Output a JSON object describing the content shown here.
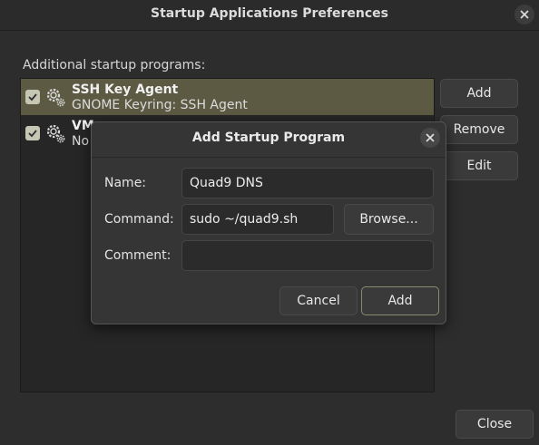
{
  "window": {
    "title": "Startup Applications Preferences"
  },
  "list": {
    "label": "Additional startup programs:",
    "items": [
      {
        "name": "SSH Key Agent",
        "description": "GNOME Keyring: SSH Agent",
        "checked": true,
        "selected": true,
        "icon": "gear-icon"
      },
      {
        "name": "VMw",
        "description": "No",
        "checked": true,
        "selected": false,
        "icon": "gear-icon"
      }
    ]
  },
  "buttons": {
    "add": "Add",
    "remove": "Remove",
    "edit": "Edit",
    "close": "Close"
  },
  "dialog": {
    "title": "Add Startup Program",
    "name_label": "Name:",
    "name_value": "Quad9 DNS",
    "command_label": "Command:",
    "command_value": "sudo ~/quad9.sh",
    "browse_label": "Browse...",
    "comment_label": "Comment:",
    "comment_value": "",
    "cancel_label": "Cancel",
    "add_label": "Add"
  },
  "colors": {
    "selected_row": "#5c5a42",
    "window_bg": "#2d2d2d",
    "dialog_bg": "#353535"
  }
}
